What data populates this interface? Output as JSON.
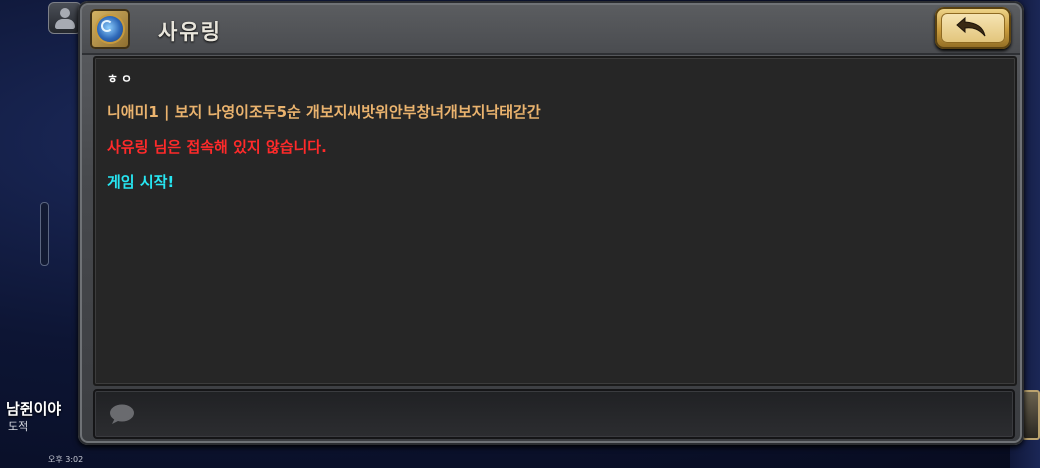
{
  "window": {
    "title": "사유링",
    "back_icon": "back-arrow-icon",
    "app_icon": "hearthstone-logo-icon"
  },
  "messages": [
    {
      "text": "ㅎㅇ",
      "color": "#ffffff"
    },
    {
      "text": "니애미1 | 보지 나영이조두5순 개보지씨밧위안부창녀개보지낙태갇간",
      "color": "#eab36e"
    },
    {
      "text": "사유링 님은 접속해 있지 않습니다.",
      "color": "#ff2a2a"
    },
    {
      "text": "게임 시작!",
      "color": "#27e6f2"
    }
  ],
  "input": {
    "value": "",
    "placeholder": "",
    "icon": "chat-bubble-icon"
  },
  "player": {
    "name": "남쥔이야",
    "class": "도적"
  },
  "status": {
    "clock": "오후 3:02"
  }
}
